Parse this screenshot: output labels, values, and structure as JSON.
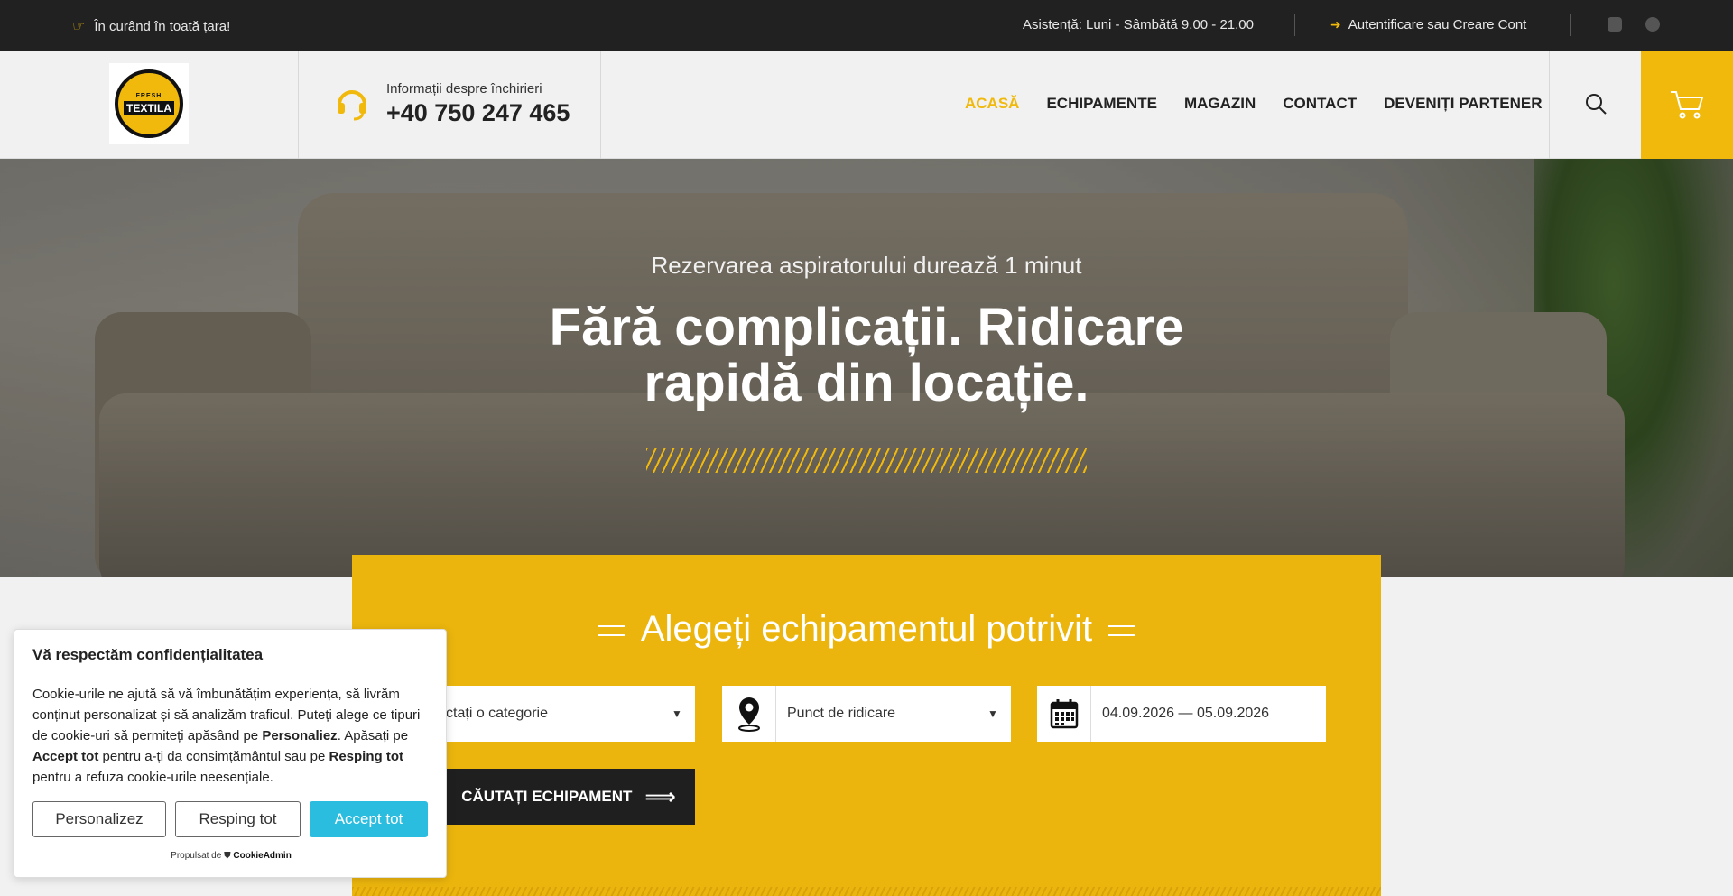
{
  "topbar": {
    "left_text": "În curând în toată țara!",
    "support": "Asistență: Luni - Sâmbătă 9.00 - 21.00",
    "login": "Autentificare sau Creare Cont",
    "social_icons": [
      "instagram-icon",
      "whatsapp-icon"
    ]
  },
  "header": {
    "logo": {
      "top": "FRESH",
      "bottom": "TEXTILA"
    },
    "phone_label": "Informații despre închirieri",
    "phone_number": "+40 750 247 465",
    "nav": [
      "ACASĂ",
      "ECHIPAMENTE",
      "MAGAZIN",
      "CONTACT",
      "DEVENIȚI PARTENER"
    ],
    "active_nav": "ACASĂ"
  },
  "hero": {
    "subtitle": "Rezervarea aspiratorului durează 1 minut",
    "title": "Fără complicații. Ridicare rapidă din locație."
  },
  "search_panel": {
    "title": "Alegeți echipamentul potrivit",
    "category_placeholder": "Selectați o categorie",
    "pickup_placeholder": "Punct de ridicare",
    "date_range": "04.09.2026  —  05.09.2026",
    "search_button": "CĂUTAȚI ECHIPAMENT"
  },
  "cookie": {
    "title": "Vă respectăm confidențialitatea",
    "text_1": "Cookie-urile ne ajută să vă îmbunătățim experiența, să livrăm conținut personalizat și să analizăm traficul. Puteți alege ce tipuri de cookie-uri să permiteți apăsând pe ",
    "bold_1": "Personaliez",
    "text_2": ". Apăsați pe ",
    "bold_2": "Accept tot",
    "text_3": " pentru a-ți da consimțământul sau pe ",
    "bold_3": "Resping tot",
    "text_4": " pentru a refuza cookie-urile neesențiale.",
    "btn_customize": "Personalizez",
    "btn_reject": "Resping tot",
    "btn_accept": "Accept tot",
    "powered_label": "Propulsat de",
    "powered_brand": "CookieAdmin"
  },
  "colors": {
    "accent": "#f0b90b",
    "panel": "#ebb50d",
    "dark": "#212121",
    "accept": "#2bbde0"
  }
}
